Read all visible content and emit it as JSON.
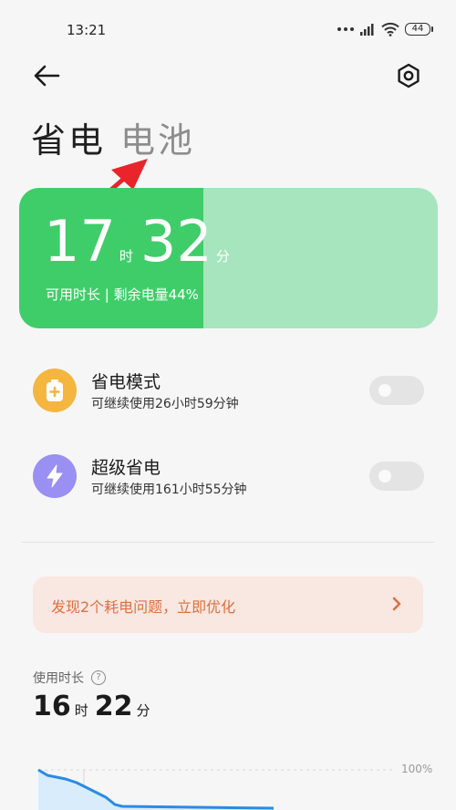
{
  "status_bar": {
    "time": "13:21",
    "battery_level": "44"
  },
  "header": {
    "tabs": {
      "save": "省电",
      "battery": "电池"
    }
  },
  "battery_card": {
    "hours": "17",
    "hour_unit": "时",
    "minutes": "32",
    "minute_unit": "分",
    "subtitle": "可用时长 | 剩余电量44%",
    "level_percent": 44,
    "fill_color": "#3fcd69",
    "bg_color": "#a6e5bd"
  },
  "modes": [
    {
      "title": "省电模式",
      "subtitle": "可继续使用26小时59分钟",
      "icon": "battery-plus-icon",
      "icon_color": "#f4b63f",
      "enabled": false
    },
    {
      "title": "超级省电",
      "subtitle": "可继续使用161小时55分钟",
      "icon": "lightning-icon",
      "icon_color": "#9a8ff2",
      "enabled": false
    }
  ],
  "issue_banner": {
    "text": "发现2个耗电问题，立即优化",
    "color": "#e0703f"
  },
  "usage": {
    "label": "使用时长",
    "hours": "16",
    "hour_unit": "时",
    "minutes": "22",
    "minute_unit": "分",
    "chart_max_label": "100%"
  }
}
